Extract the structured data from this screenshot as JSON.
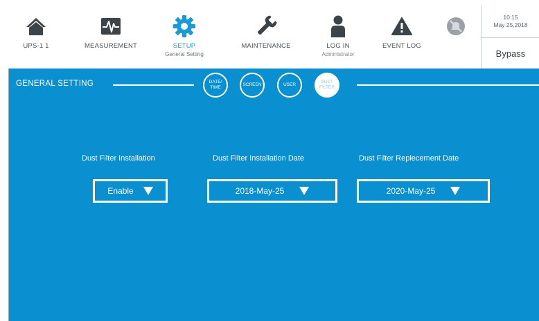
{
  "nav": {
    "items": [
      {
        "label": "UPS-1 1",
        "sub": "",
        "icon": "home-icon"
      },
      {
        "label": "MEASUREMENT",
        "sub": "",
        "icon": "waveform-icon"
      },
      {
        "label": "SETUP",
        "sub": "General Setting",
        "icon": "gear-icon"
      },
      {
        "label": "MAINTENANCE",
        "sub": "",
        "icon": "wrench-icon"
      },
      {
        "label": "LOG IN",
        "sub": "Administrator",
        "icon": "user-icon"
      },
      {
        "label": "EVENT LOG",
        "sub": "",
        "icon": "warning-icon"
      },
      {
        "label": "",
        "sub": "",
        "icon": "mute-icon"
      }
    ],
    "active_item": "SETUP",
    "clock": {
      "time": "10:15",
      "date": "May 25,2018"
    },
    "mode": "Bypass"
  },
  "general_setting": {
    "title": "GENERAL SETTING",
    "tabs": [
      {
        "line1": "DATE/",
        "line2": "TIME"
      },
      {
        "line1": "SCREEN",
        "line2": ""
      },
      {
        "line1": "USER",
        "line2": ""
      },
      {
        "line1": "DUST",
        "line2": "FILTER"
      }
    ],
    "active_tab": "DUST FILTER",
    "fields": [
      {
        "label": "Dust Filter Installation",
        "value": "Enable"
      },
      {
        "label": "Dust Filter Installation Date",
        "value": "2018-May-25"
      },
      {
        "label": "Dust Filter Replecement Date",
        "value": "2020-May-25"
      }
    ]
  },
  "colors": {
    "panel_blue": "#0a8fd0",
    "active_nav_text": "#2a9bd6",
    "icon_gray": "#3c4349",
    "icon_accent_blue": "#1b9ad6"
  }
}
